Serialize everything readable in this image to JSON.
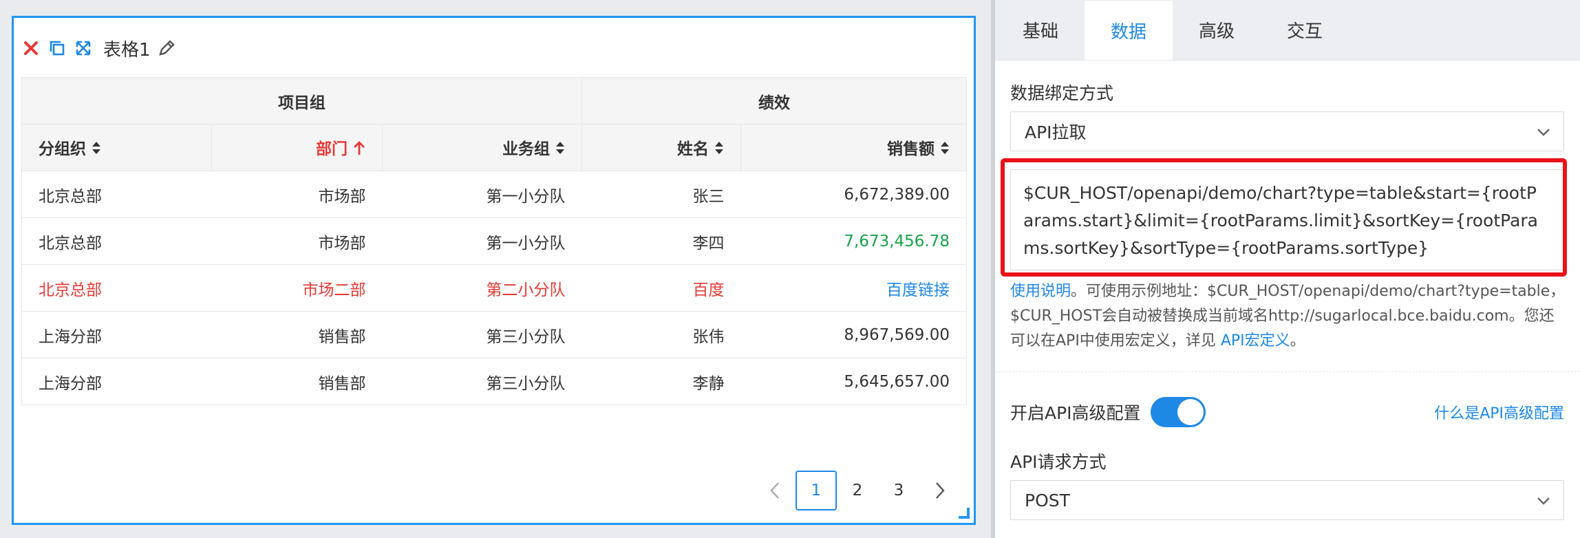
{
  "widget": {
    "title": "表格1",
    "icons": [
      "close-icon",
      "copy-icon",
      "expand-icon",
      "pencil-icon"
    ],
    "table": {
      "groups": [
        "项目组",
        "绩效"
      ],
      "columns": [
        "分组织",
        "部门",
        "业务组",
        "姓名",
        "销售额"
      ],
      "rows": [
        [
          "北京总部",
          "市场部",
          "第一小分队",
          "张三",
          "6,672,389.00"
        ],
        [
          "北京总部",
          "市场部",
          "第一小分队",
          "李四",
          "7,673,456.78"
        ],
        [
          "北京总部",
          "市场二部",
          "第二小分队",
          "百度",
          "百度链接"
        ],
        [
          "上海分部",
          "销售部",
          "第三小分队",
          "张伟",
          "8,967,569.00"
        ],
        [
          "上海分部",
          "销售部",
          "第三小分队",
          "李静",
          "5,645,657.00"
        ]
      ]
    },
    "pager": {
      "pages": [
        "1",
        "2",
        "3"
      ],
      "current": "1"
    }
  },
  "panel": {
    "tabs": [
      "基础",
      "数据",
      "高级",
      "交互"
    ],
    "active_tab": "数据",
    "binding_label": "数据绑定方式",
    "binding_value": "API拉取",
    "url": "$CUR_HOST/openapi/demo/chart?type=table&start={rootParams.start}&limit={rootParams.limit}&sortKey={rootParams.sortKey}&sortType={rootParams.sortType}",
    "help_link": "使用说明",
    "help_text": "。可使用示例地址：$CUR_HOST/openapi/demo/chart?type=table，$CUR_HOST会自动被替换成当前域名http://sugarlocal.bce.baidu.com。您还可以在API中使用宏定义，详见 ",
    "help_link2": "API宏定义",
    "help_end": "。",
    "adv_label": "开启API高级配置",
    "adv_enabled": true,
    "adv_link": "什么是API高级配置",
    "method_label": "API请求方式",
    "method_value": "POST"
  },
  "colors": {
    "accent": "#1e88e5",
    "highlight": "#e8141b",
    "red_text": "#e53935",
    "green_text": "#17a34a"
  }
}
